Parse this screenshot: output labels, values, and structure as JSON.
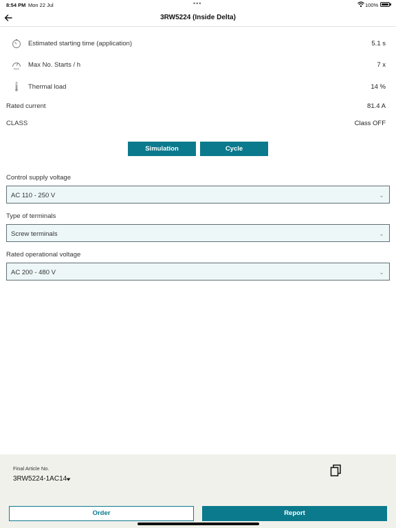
{
  "status_bar": {
    "time": "8:54 PM",
    "date": "Mon 22 Jul",
    "dots": "•••",
    "battery_pct": "100%"
  },
  "nav": {
    "title": "3RW5224 (Inside Delta)",
    "back_icon": "arrow-left-icon"
  },
  "metrics": [
    {
      "icon": "stopwatch-icon",
      "label": "Estimated starting time (application)",
      "value": "5.1 s"
    },
    {
      "icon": "gauge-max-icon",
      "label": "Max No. Starts / h",
      "value": "7 x"
    },
    {
      "icon": "thermometer-icon",
      "label": "Thermal load",
      "value": "14 %"
    }
  ],
  "specs": [
    {
      "label": "Rated current",
      "value": "81.4 A"
    },
    {
      "label": "CLASS",
      "value": "Class OFF"
    }
  ],
  "actions": {
    "simulation": "Simulation",
    "cycle": "Cycle"
  },
  "fields": [
    {
      "label": "Control supply voltage",
      "value": "AC 110 - 250 V"
    },
    {
      "label": "Type of terminals",
      "value": "Screw terminals"
    },
    {
      "label": "Rated operational voltage",
      "value": "AC 200 - 480 V"
    }
  ],
  "footer": {
    "final_article_label": "Final Article No.",
    "final_article_value": "3RW5224-1AC14",
    "order": "Order",
    "report": "Report"
  },
  "colors": {
    "accent": "#0b7a8d",
    "field_bg": "#eef7f8",
    "footer_bg": "#f1f1ec"
  }
}
